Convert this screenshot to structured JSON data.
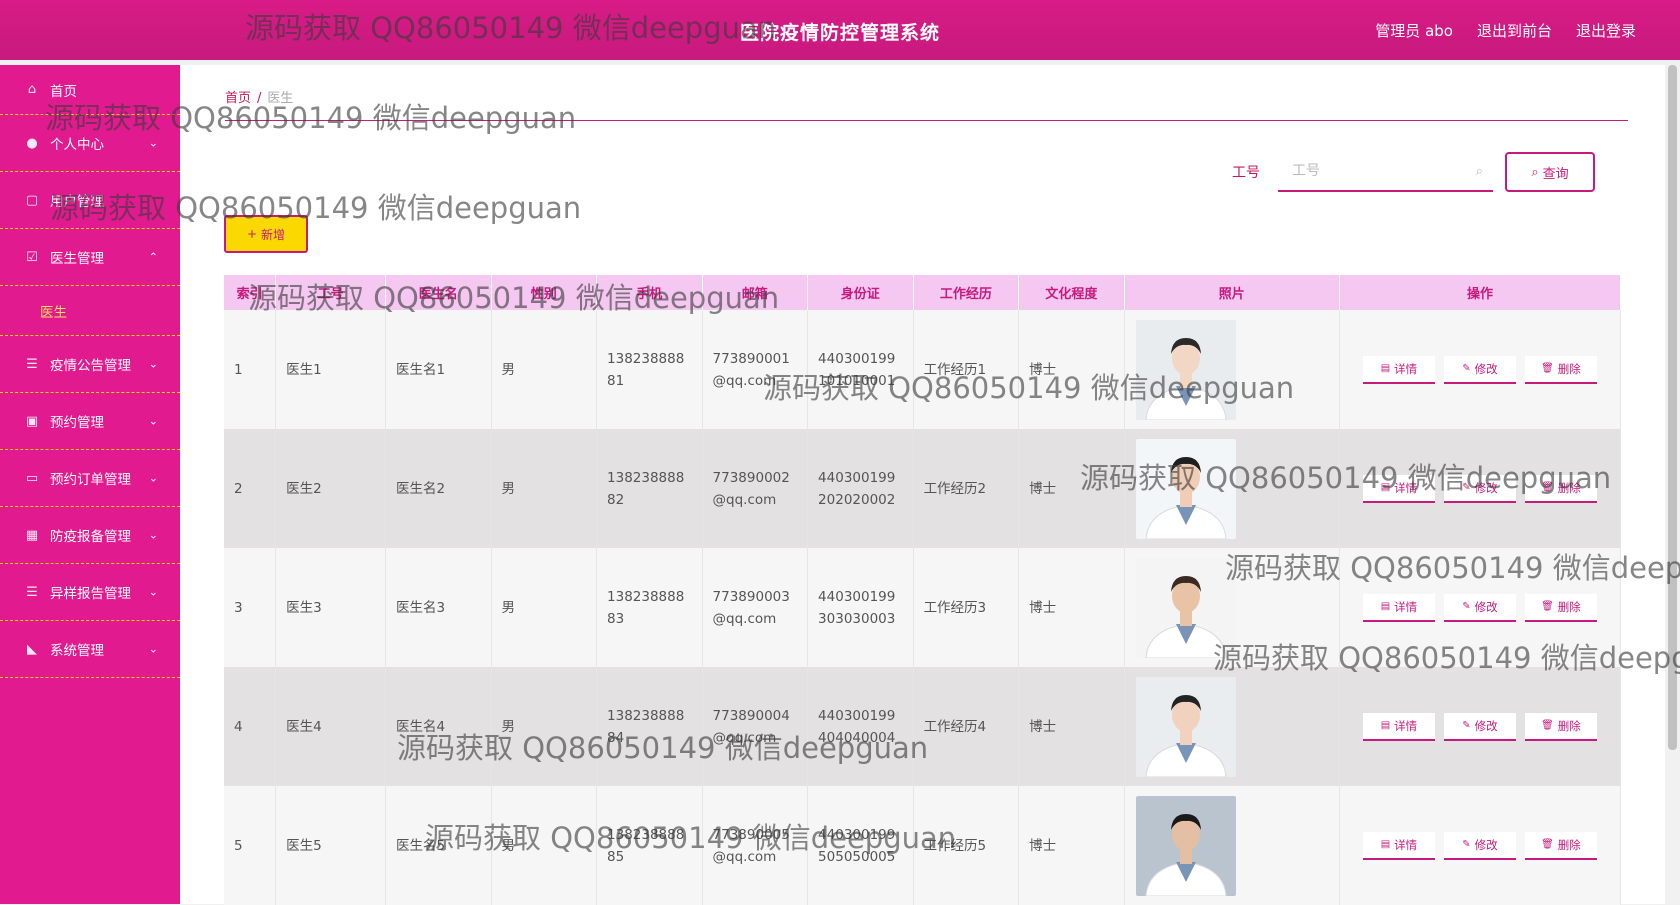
{
  "header": {
    "title": "医院疫情防控管理系统",
    "links": [
      "管理员 abo",
      "退出到前台",
      "退出登录"
    ]
  },
  "sidebar": {
    "items": [
      {
        "label": "首页",
        "icon": "home-icon",
        "chev": ""
      },
      {
        "label": "个人中心",
        "icon": "user-icon",
        "chev": "⌄"
      },
      {
        "label": "用户管理",
        "icon": "copy-icon",
        "chev": ""
      },
      {
        "label": "医生管理",
        "icon": "check-square-icon",
        "chev": "⌃"
      },
      {
        "label": "疫情公告管理",
        "icon": "list-icon",
        "chev": "⌄"
      },
      {
        "label": "预约管理",
        "icon": "clipboard-icon",
        "chev": "⌄"
      },
      {
        "label": "预约订单管理",
        "icon": "chat-icon",
        "chev": "⌄"
      },
      {
        "label": "防疫报备管理",
        "icon": "building-icon",
        "chev": "⌄"
      },
      {
        "label": "异样报告管理",
        "icon": "list-icon",
        "chev": "⌄"
      },
      {
        "label": "系统管理",
        "icon": "thumbs-up-icon",
        "chev": "⌄"
      }
    ],
    "sub_item": "医生"
  },
  "breadcrumb": {
    "home": "首页",
    "sep": "/",
    "current": "医生"
  },
  "search": {
    "label": "工号",
    "placeholder": "工号",
    "button": "查询"
  },
  "add_button": "新增",
  "table": {
    "headers": [
      "索引",
      "工号",
      "医生名",
      "性别",
      "手机",
      "邮箱",
      "身份证",
      "工作经历",
      "文化程度",
      "照片",
      "操作"
    ],
    "rows": [
      [
        "1",
        "医生1",
        "医生名1",
        "男",
        "13823888881",
        "773890001@qq.com",
        "440300199101010001",
        "工作经历1",
        "博士"
      ],
      [
        "2",
        "医生2",
        "医生名2",
        "男",
        "13823888882",
        "773890002@qq.com",
        "440300199202020002",
        "工作经历2",
        "博士"
      ],
      [
        "3",
        "医生3",
        "医生名3",
        "男",
        "13823888883",
        "773890003@qq.com",
        "440300199303030003",
        "工作经历3",
        "博士"
      ],
      [
        "4",
        "医生4",
        "医生名4",
        "男",
        "13823888884",
        "773890004@qq.com",
        "440300199404040004",
        "工作经历4",
        "博士"
      ],
      [
        "5",
        "医生5",
        "医生名5",
        "男",
        "13823888885",
        "773890005@qq.com",
        "440300199505050005",
        "工作经历5",
        "博士"
      ]
    ],
    "ops": [
      "详情",
      "修改",
      "删除"
    ]
  },
  "watermark": "源码获取 QQ86050149 微信deepguan",
  "colors": {
    "primary": "#c71a7e",
    "sidebar": "#e21a8f",
    "accent": "#fbd900"
  }
}
